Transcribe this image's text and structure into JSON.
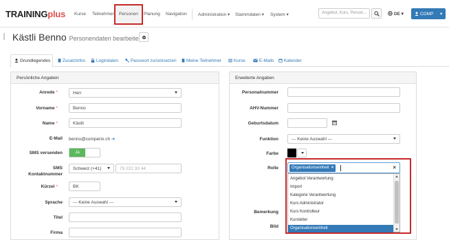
{
  "brand": {
    "part1": "TRAINING",
    "part2": "plus"
  },
  "nav": {
    "items": [
      "Kurse",
      "Teilnehmer",
      "Personen",
      "Planung",
      "Navigation"
    ],
    "admin_items": [
      "Administration ▾",
      "Stammdaten ▾",
      "System ▾"
    ],
    "search_placeholder": "Angebot, Kurs, Person...",
    "language": "DE ▾",
    "user_button": "COMP"
  },
  "header": {
    "title": "Kästli Benno",
    "subtitle": "Personendaten bearbeiten"
  },
  "tabs": [
    {
      "label": "Grundlegendes",
      "icon": "user-icon"
    },
    {
      "label": "Zusatzinfos",
      "icon": "file-icon"
    },
    {
      "label": "Logindaten",
      "icon": "lock-icon"
    },
    {
      "label": "Passwort zurücksetzen",
      "icon": "key-icon"
    },
    {
      "label": "Meine Teilnehmer",
      "icon": "book-icon"
    },
    {
      "label": "Kurse",
      "icon": "list-icon"
    },
    {
      "label": "E-Mails",
      "icon": "envelope-icon"
    },
    {
      "label": "Kalender",
      "icon": "calendar-icon"
    }
  ],
  "left_panel": {
    "title": "Persönliche Angaben",
    "fields": {
      "anrede": {
        "label": "Anrede",
        "value": "Herr"
      },
      "vorname": {
        "label": "Vorname",
        "value": "Benno"
      },
      "name": {
        "label": "Name",
        "value": "Kästli"
      },
      "email": {
        "label": "E-Mail",
        "value": "benno@comperio.ch"
      },
      "sms": {
        "label": "SMS versenden",
        "value": "Ja"
      },
      "sms_nummer": {
        "label": "SMS",
        "label2": "Kontaktnummer",
        "country": "Schweiz (+41)",
        "placeholder": "79 222 33 44"
      },
      "kuerzel": {
        "label": "Kürzel",
        "value": "BK"
      },
      "sprache": {
        "label": "Sprache",
        "value": "--- Keine Auswahl ---"
      },
      "titel": {
        "label": "Titel",
        "value": ""
      },
      "firma": {
        "label": "Firma",
        "value": ""
      }
    }
  },
  "right_panel": {
    "title": "Erweiterte Angaben",
    "fields": {
      "personalnummer": {
        "label": "Personalnummer"
      },
      "ahv": {
        "label": "AHV-Nummer"
      },
      "geburtsdatum": {
        "label": "Geburtsdatum"
      },
      "funktion": {
        "label": "Funktion",
        "value": "--- Keine Auswahl ---"
      },
      "farbe": {
        "label": "Farbe",
        "color": "#000000"
      },
      "rolle": {
        "label": "Rolle",
        "selected_tag": "Organisationseinheit",
        "options": [
          "Angebot Verantwortung",
          "Import",
          "Kategorie Verantwortung",
          "Kurs Administrator",
          "Kurs Kontrolleur",
          "Kursleiter",
          "Organisationseinheit"
        ],
        "highlighted_option": "Organisationseinheit"
      },
      "bemerkung": {
        "label": "Bemerkung"
      },
      "bild": {
        "label": "Bild"
      }
    }
  },
  "colors": {
    "accent": "#337ab7",
    "brand_red": "#d9534f",
    "highlight_box": "#c62828",
    "toggle_green": "#5cb85c"
  }
}
